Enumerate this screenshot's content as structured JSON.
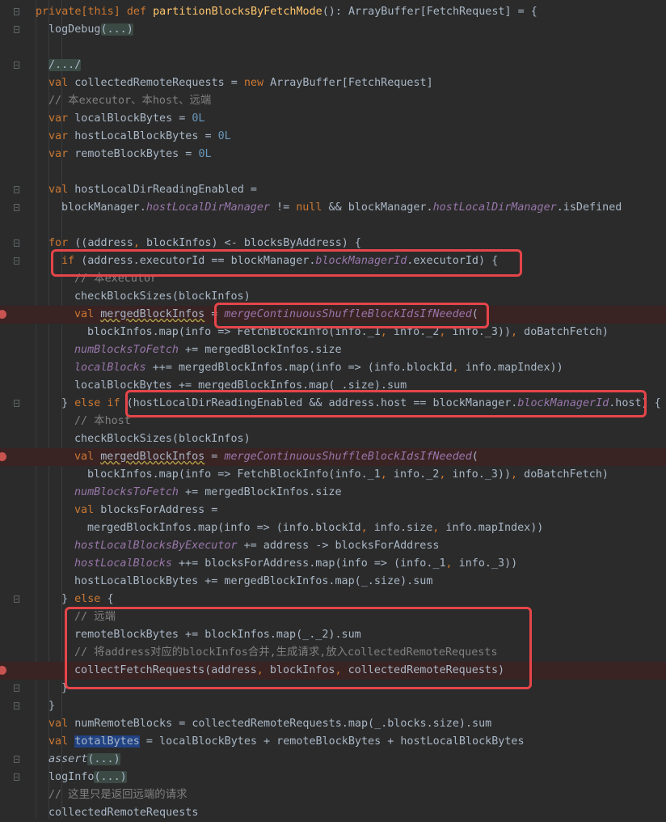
{
  "editor": {
    "lines": [
      {
        "indent": 0,
        "fold": true,
        "bp": false,
        "html_parts": [
          [
            "kw",
            "private[this] "
          ],
          [
            "kw",
            "def "
          ],
          [
            "fn",
            "partitionBlocksByFetchMode"
          ],
          [
            "p",
            "(): ArrayBuffer[FetchRequest] = {"
          ]
        ]
      },
      {
        "indent": 1,
        "fold": true,
        "bp": false,
        "html_parts": [
          [
            "p",
            "logDebug"
          ],
          [
            "fb",
            "(...)"
          ]
        ]
      },
      {
        "indent": 0,
        "fold": false,
        "bp": false,
        "html_parts": [
          [
            "p",
            ""
          ]
        ]
      },
      {
        "indent": 1,
        "fold": true,
        "bp": false,
        "html_parts": [
          [
            "fb",
            "/.../"
          ]
        ]
      },
      {
        "indent": 1,
        "fold": false,
        "bp": false,
        "html_parts": [
          [
            "kw",
            "val "
          ],
          [
            "p",
            "collectedRemoteRequests = "
          ],
          [
            "kw",
            "new "
          ],
          [
            "p",
            "ArrayBuffer[FetchRequest]"
          ]
        ]
      },
      {
        "indent": 1,
        "fold": false,
        "bp": false,
        "html_parts": [
          [
            "cm",
            "// 本executor、本host、远端"
          ]
        ]
      },
      {
        "indent": 1,
        "fold": false,
        "bp": false,
        "html_parts": [
          [
            "kw",
            "var "
          ],
          [
            "p",
            "localBlockBytes = "
          ],
          [
            "num",
            "0L"
          ]
        ]
      },
      {
        "indent": 1,
        "fold": false,
        "bp": false,
        "html_parts": [
          [
            "kw",
            "var "
          ],
          [
            "p",
            "hostLocalBlockBytes = "
          ],
          [
            "num",
            "0L"
          ]
        ]
      },
      {
        "indent": 1,
        "fold": false,
        "bp": false,
        "html_parts": [
          [
            "kw",
            "var "
          ],
          [
            "p",
            "remoteBlockBytes = "
          ],
          [
            "num",
            "0L"
          ]
        ]
      },
      {
        "indent": 0,
        "fold": false,
        "bp": false,
        "html_parts": [
          [
            "p",
            ""
          ]
        ]
      },
      {
        "indent": 1,
        "fold": true,
        "bp": false,
        "html_parts": [
          [
            "kw",
            "val "
          ],
          [
            "p",
            "hostLocalDirReadingEnabled ="
          ]
        ]
      },
      {
        "indent": 2,
        "fold": true,
        "bp": false,
        "html_parts": [
          [
            "p",
            "blockManager."
          ],
          [
            "it",
            "hostLocalDirManager"
          ],
          [
            "p",
            " != "
          ],
          [
            "kw",
            "null"
          ],
          [
            "p",
            " && blockManager."
          ],
          [
            "it",
            "hostLocalDirManager"
          ],
          [
            "p",
            ".isDefined"
          ]
        ]
      },
      {
        "indent": 0,
        "fold": false,
        "bp": false,
        "html_parts": [
          [
            "p",
            ""
          ]
        ]
      },
      {
        "indent": 1,
        "fold": true,
        "bp": false,
        "html_parts": [
          [
            "kw",
            "for "
          ],
          [
            "p",
            "((address"
          ],
          [
            "kw",
            ", "
          ],
          [
            "p",
            "blockInfos) <- blocksByAddress) {"
          ]
        ]
      },
      {
        "indent": 2,
        "fold": true,
        "bp": false,
        "html_parts": [
          [
            "kw",
            "if "
          ],
          [
            "p",
            "(address.executorId == blockManager."
          ],
          [
            "it",
            "blockManagerId"
          ],
          [
            "p",
            ".executorId) {"
          ]
        ]
      },
      {
        "indent": 3,
        "fold": false,
        "bp": false,
        "html_parts": [
          [
            "cm",
            "// 本executor"
          ]
        ]
      },
      {
        "indent": 3,
        "fold": false,
        "bp": false,
        "html_parts": [
          [
            "p",
            "checkBlockSizes(blockInfos)"
          ]
        ]
      },
      {
        "indent": 3,
        "fold": false,
        "bp": true,
        "html_parts": [
          [
            "kw",
            "val "
          ],
          [
            "sq",
            "mergedBlockInfos"
          ],
          [
            "p",
            " = "
          ],
          [
            "it",
            "mergeContinuousShuffleBlockIdsIfNeeded"
          ],
          [
            "p",
            "("
          ]
        ]
      },
      {
        "indent": 4,
        "fold": false,
        "bp": false,
        "html_parts": [
          [
            "p",
            "blockInfos.map(info => FetchBlockInfo(info._1"
          ],
          [
            "kw",
            ", "
          ],
          [
            "p",
            "info._2"
          ],
          [
            "kw",
            ", "
          ],
          [
            "p",
            "info._3))"
          ],
          [
            "kw",
            ", "
          ],
          [
            "p",
            "doBatchFetch)"
          ]
        ]
      },
      {
        "indent": 3,
        "fold": false,
        "bp": false,
        "html_parts": [
          [
            "it",
            "numBlocksToFetch"
          ],
          [
            "p",
            " += mergedBlockInfos.size"
          ]
        ]
      },
      {
        "indent": 3,
        "fold": false,
        "bp": false,
        "html_parts": [
          [
            "it",
            "localBlocks"
          ],
          [
            "p",
            " ++= mergedBlockInfos.map(info => (info.blockId"
          ],
          [
            "kw",
            ", "
          ],
          [
            "p",
            "info.mapIndex))"
          ]
        ]
      },
      {
        "indent": 3,
        "fold": false,
        "bp": false,
        "html_parts": [
          [
            "p",
            "localBlockBytes += mergedBlockInfos.map(_.size).sum"
          ]
        ]
      },
      {
        "indent": 2,
        "fold": true,
        "bp": false,
        "html_parts": [
          [
            "p",
            "} "
          ],
          [
            "kw",
            "else if "
          ],
          [
            "p",
            "(hostLocalDirReadingEnabled && address.host == blockManager."
          ],
          [
            "it",
            "blockManagerId"
          ],
          [
            "p",
            ".host) {"
          ]
        ]
      },
      {
        "indent": 3,
        "fold": false,
        "bp": false,
        "html_parts": [
          [
            "cm",
            "// 本host"
          ]
        ]
      },
      {
        "indent": 3,
        "fold": false,
        "bp": false,
        "html_parts": [
          [
            "p",
            "checkBlockSizes(blockInfos)"
          ]
        ]
      },
      {
        "indent": 3,
        "fold": false,
        "bp": true,
        "html_parts": [
          [
            "kw",
            "val "
          ],
          [
            "sq",
            "mergedBlockInfos"
          ],
          [
            "p",
            " = "
          ],
          [
            "it",
            "mergeContinuousShuffleBlockIdsIfNeeded"
          ],
          [
            "p",
            "("
          ]
        ]
      },
      {
        "indent": 4,
        "fold": false,
        "bp": false,
        "html_parts": [
          [
            "p",
            "blockInfos.map(info => FetchBlockInfo(info._1"
          ],
          [
            "kw",
            ", "
          ],
          [
            "p",
            "info._2"
          ],
          [
            "kw",
            ", "
          ],
          [
            "p",
            "info._3))"
          ],
          [
            "kw",
            ", "
          ],
          [
            "p",
            "doBatchFetch)"
          ]
        ]
      },
      {
        "indent": 3,
        "fold": false,
        "bp": false,
        "html_parts": [
          [
            "it",
            "numBlocksToFetch"
          ],
          [
            "p",
            " += mergedBlockInfos.size"
          ]
        ]
      },
      {
        "indent": 3,
        "fold": false,
        "bp": false,
        "html_parts": [
          [
            "kw",
            "val "
          ],
          [
            "p",
            "blocksForAddress ="
          ]
        ]
      },
      {
        "indent": 4,
        "fold": false,
        "bp": false,
        "html_parts": [
          [
            "p",
            "mergedBlockInfos.map(info => (info.blockId"
          ],
          [
            "kw",
            ", "
          ],
          [
            "p",
            "info.size"
          ],
          [
            "kw",
            ", "
          ],
          [
            "p",
            "info.mapIndex))"
          ]
        ]
      },
      {
        "indent": 3,
        "fold": false,
        "bp": false,
        "html_parts": [
          [
            "it",
            "hostLocalBlocksByExecutor"
          ],
          [
            "p",
            " += address -> blocksForAddress"
          ]
        ]
      },
      {
        "indent": 3,
        "fold": false,
        "bp": false,
        "html_parts": [
          [
            "it",
            "hostLocalBlocks"
          ],
          [
            "p",
            " ++= blocksForAddress.map(info => (info._1"
          ],
          [
            "kw",
            ", "
          ],
          [
            "p",
            "info._3))"
          ]
        ]
      },
      {
        "indent": 3,
        "fold": false,
        "bp": false,
        "html_parts": [
          [
            "p",
            "hostLocalBlockBytes += mergedBlockInfos.map(_.size).sum"
          ]
        ]
      },
      {
        "indent": 2,
        "fold": true,
        "bp": false,
        "html_parts": [
          [
            "p",
            "} "
          ],
          [
            "kw",
            "else "
          ],
          [
            "p",
            "{"
          ]
        ]
      },
      {
        "indent": 3,
        "fold": false,
        "bp": false,
        "html_parts": [
          [
            "cm",
            "// 远端"
          ]
        ]
      },
      {
        "indent": 3,
        "fold": false,
        "bp": false,
        "html_parts": [
          [
            "p",
            "remoteBlockBytes += blockInfos.map(_._2).sum"
          ]
        ]
      },
      {
        "indent": 3,
        "fold": false,
        "bp": false,
        "html_parts": [
          [
            "cm",
            "// 将address对应的blockInfos合并,生成请求,放入collectedRemoteRequests"
          ]
        ]
      },
      {
        "indent": 3,
        "fold": false,
        "bp": true,
        "html_parts": [
          [
            "p",
            "collectFetchRequests(address"
          ],
          [
            "kw",
            ", "
          ],
          [
            "p",
            "blockInfos"
          ],
          [
            "kw",
            ", "
          ],
          [
            "p",
            "collectedRemoteRequests)"
          ]
        ]
      },
      {
        "indent": 2,
        "fold": true,
        "bp": false,
        "html_parts": [
          [
            "p",
            "}"
          ]
        ]
      },
      {
        "indent": 1,
        "fold": true,
        "bp": false,
        "html_parts": [
          [
            "p",
            "}"
          ]
        ]
      },
      {
        "indent": 1,
        "fold": false,
        "bp": false,
        "html_parts": [
          [
            "kw",
            "val "
          ],
          [
            "p",
            "numRemoteBlocks = collectedRemoteRequests.map(_.blocks.size).sum"
          ]
        ]
      },
      {
        "indent": 1,
        "fold": false,
        "bp": false,
        "html_parts": [
          [
            "kw",
            "val "
          ],
          [
            "sel",
            "totalBytes"
          ],
          [
            "p",
            " = localBlockBytes + remoteBlockBytes + hostLocalBlockBytes"
          ]
        ]
      },
      {
        "indent": 1,
        "fold": true,
        "bp": false,
        "html_parts": [
          [
            "italic",
            "assert"
          ],
          [
            "fb",
            "(...)"
          ]
        ]
      },
      {
        "indent": 1,
        "fold": true,
        "bp": false,
        "html_parts": [
          [
            "p",
            "logInfo"
          ],
          [
            "fb",
            "(...)"
          ]
        ]
      },
      {
        "indent": 1,
        "fold": false,
        "bp": false,
        "html_parts": [
          [
            "cm",
            "// 这里只是返回远端的请求"
          ]
        ]
      },
      {
        "indent": 1,
        "fold": false,
        "bp": false,
        "html_parts": [
          [
            "p",
            "collectedRemoteRequests"
          ]
        ]
      }
    ]
  }
}
